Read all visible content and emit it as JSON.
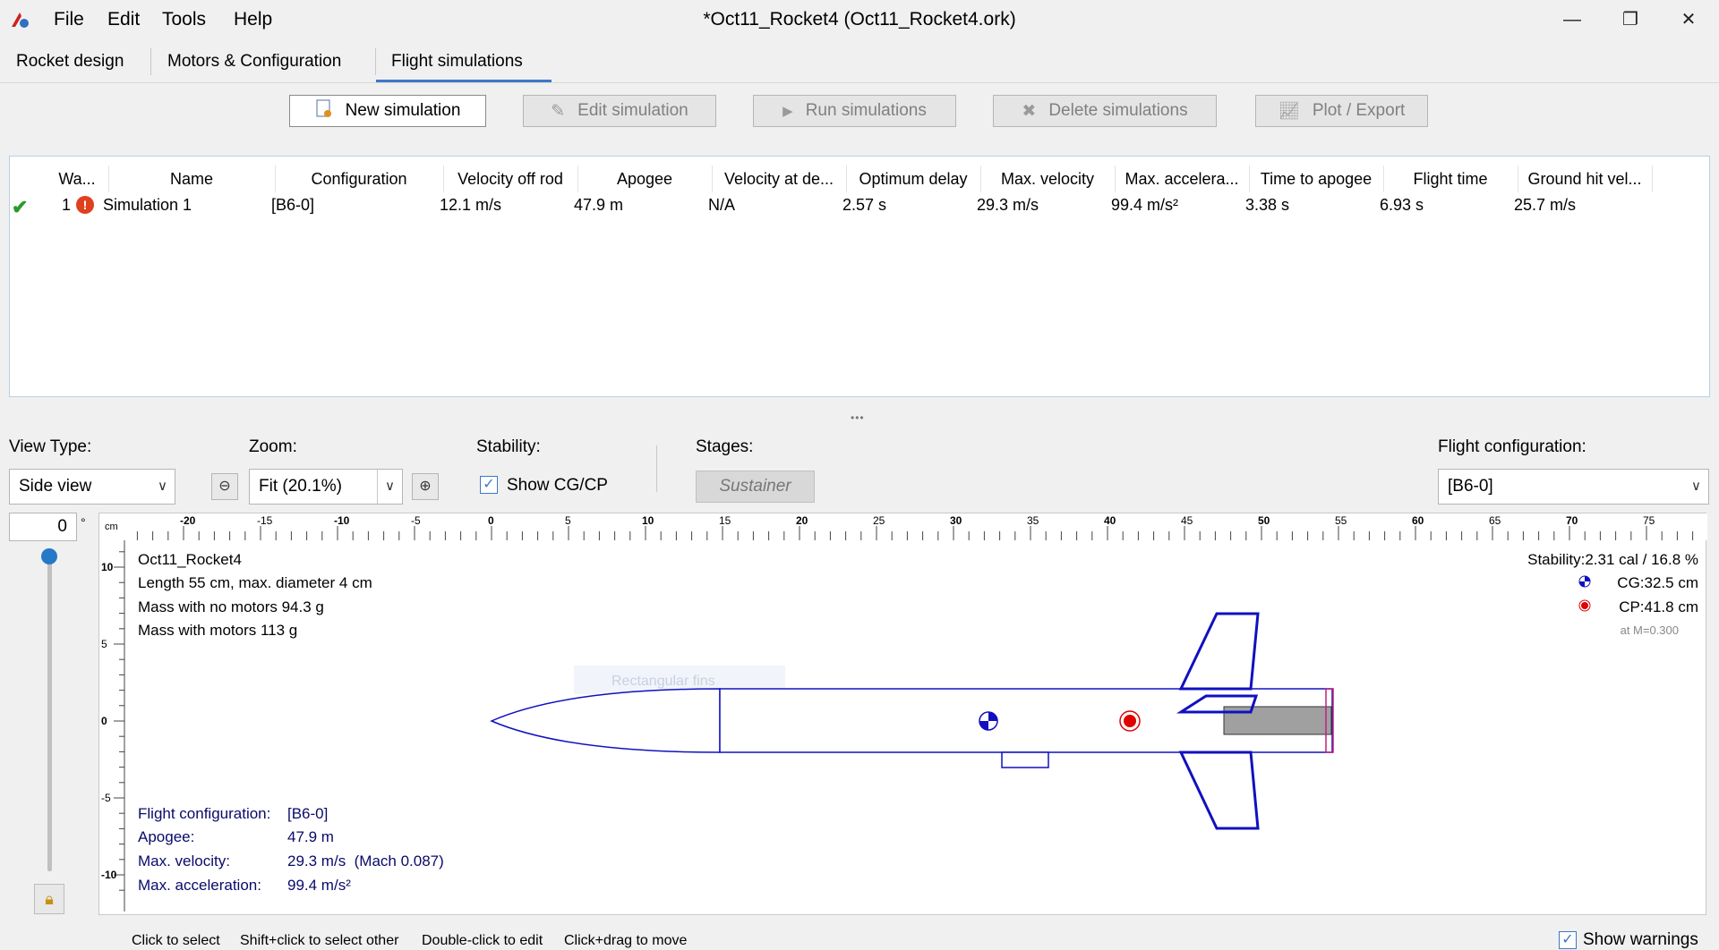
{
  "window": {
    "title": "*Oct11_Rocket4 (Oct11_Rocket4.ork)",
    "menu": [
      "File",
      "Edit",
      "Tools",
      "Help"
    ],
    "controls": {
      "minimize": "—",
      "restore": "❐",
      "close": "✕"
    }
  },
  "tabs": [
    "Rocket design",
    "Motors & Configuration",
    "Flight simulations"
  ],
  "active_tab": "Flight simulations",
  "toolbar": {
    "new": "New simulation",
    "edit": "Edit simulation",
    "run": "Run simulations",
    "delete": "Delete simulations",
    "plot": "Plot / Export"
  },
  "table": {
    "headers": [
      "Wa...",
      "Name",
      "Configuration",
      "Velocity off rod",
      "Apogee",
      "Velocity at de...",
      "Optimum delay",
      "Max. velocity",
      "Max. accelera...",
      "Time to apogee",
      "Flight time",
      "Ground hit vel..."
    ],
    "rows": [
      {
        "num": "1",
        "name": "Simulation 1",
        "configuration": "[B6-0]",
        "velocity_off_rod": "12.1 m/s",
        "apogee": "47.9 m",
        "velocity_deploy": "N/A",
        "optimum_delay": "2.57 s",
        "max_velocity": "29.3 m/s",
        "max_accel": "99.4 m/s²",
        "time_to_apogee": "3.38 s",
        "flight_time": "6.93 s",
        "ground_hit": "25.7 m/s"
      }
    ]
  },
  "controls": {
    "view_type_label": "View Type:",
    "view_type_value": "Side view",
    "zoom_label": "Zoom:",
    "zoom_value": "Fit (20.1%)",
    "stability_label": "Stability:",
    "show_cgcp": "Show CG/CP",
    "stages_label": "Stages:",
    "stage_button": "Sustainer",
    "flight_config_label": "Flight configuration:",
    "flight_config_value": "[B6-0]",
    "rotation_value": "0",
    "rotation_unit": "°",
    "split_handle": "•••"
  },
  "ruler": {
    "unit": "cm",
    "h_labels": [
      "-20",
      "-15",
      "-10",
      "-5",
      "0",
      "5",
      "10",
      "15",
      "20",
      "25",
      "30",
      "35",
      "40",
      "45",
      "50",
      "55",
      "60",
      "65",
      "70",
      "75"
    ],
    "v_labels": [
      "10",
      "5",
      "0",
      "-5",
      "-10"
    ]
  },
  "rocket_info": {
    "name": "Oct11_Rocket4",
    "length": "Length 55 cm, max. diameter 4 cm",
    "mass_no_motors": "Mass with no motors 94.3 g",
    "mass_with_motors": "Mass with motors 113 g",
    "stability": "Stability:2.31 cal / 16.8 %",
    "cg": "CG:32.5 cm",
    "cp": "CP:41.8 cm",
    "mach": "at M=0.300",
    "ghost_label": "Rectangular fins"
  },
  "flight_info": {
    "config_label": "Flight configuration:",
    "config_value": "[B6-0]",
    "apogee_label": "Apogee:",
    "apogee_value": "47.9 m",
    "velocity_label": "Max. velocity:",
    "velocity_value": "29.3 m/s  (Mach 0.087)",
    "accel_label": "Max. acceleration:",
    "accel_value": "99.4 m/s²"
  },
  "status": {
    "hint1": "Click to select",
    "hint2": "Shift+click to select other",
    "hint3": "Double-click to edit",
    "hint4": "Click+drag to move",
    "show_warnings": "Show warnings"
  },
  "colors": {
    "accent": "#3c78c8",
    "rocket_outline": "#1010c0",
    "cp_red": "#e00000",
    "motor_gray": "#a0a0a0",
    "info_text": "#0a0a6a"
  }
}
